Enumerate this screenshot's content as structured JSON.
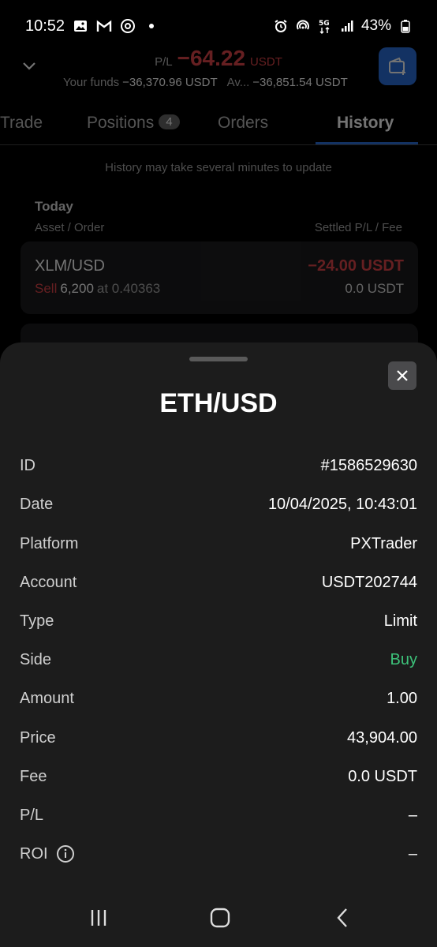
{
  "status_bar": {
    "time": "10:52",
    "battery": "43%",
    "icons": [
      "gallery-icon",
      "gmail-icon",
      "threads-icon",
      "dot-icon",
      "alarm-icon",
      "hotspot-icon",
      "5g-icon",
      "signal-icon",
      "battery-icon"
    ]
  },
  "header": {
    "pl_label": "P/L",
    "pl_value": "−64.22",
    "pl_unit": "USDT",
    "funds_label": "Your funds",
    "funds_value": "−36,370.96 USDT",
    "av_label": "Av...",
    "av_value": "−36,851.54 USDT"
  },
  "tabs": [
    {
      "label": "Trade"
    },
    {
      "label": "Positions",
      "badge": "4"
    },
    {
      "label": "Orders"
    },
    {
      "label": "History",
      "active": true
    }
  ],
  "history": {
    "note": "History may take several minutes to update",
    "day": "Today",
    "col_left": "Asset / Order",
    "col_right": "Settled P/L / Fee",
    "rows": [
      {
        "asset": "XLM/USD",
        "side": "Sell",
        "amount": "6,200",
        "at": "at 0.40363",
        "pl": "−24.00 USDT",
        "fee": "0.0 USDT"
      }
    ]
  },
  "sheet": {
    "title": "ETH/USD",
    "rows": [
      {
        "label": "ID",
        "value": "#1586529630"
      },
      {
        "label": "Date",
        "value": "10/04/2025, 10:43:01"
      },
      {
        "label": "Platform",
        "value": "PXTrader"
      },
      {
        "label": "Account",
        "value": "USDT202744"
      },
      {
        "label": "Type",
        "value": "Limit"
      },
      {
        "label": "Side",
        "value": "Buy"
      },
      {
        "label": "Amount",
        "value": "1.00"
      },
      {
        "label": "Price",
        "value": "43,904.00"
      },
      {
        "label": "Fee",
        "value": "0.0 USDT"
      },
      {
        "label": "P/L",
        "value": "–"
      },
      {
        "label": "ROI",
        "value": "–"
      }
    ]
  },
  "colors": {
    "accent": "#2a6fdb",
    "negative": "#e0464a",
    "positive": "#3dc27a",
    "sheet_bg": "#1c1c1c"
  }
}
